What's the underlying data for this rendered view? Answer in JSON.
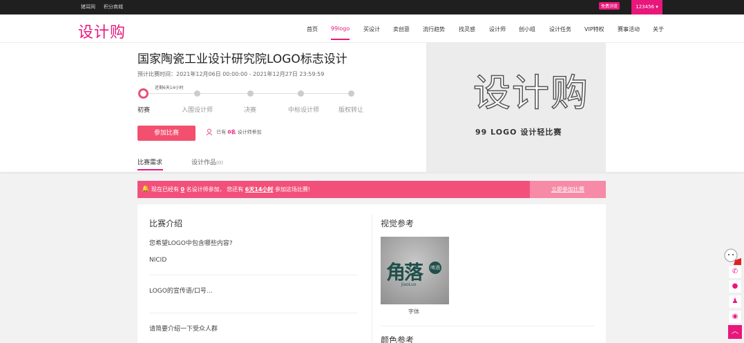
{
  "topbar": {
    "links": [
      "猪耳网",
      "积分商城"
    ],
    "user": "123456 ▾"
  },
  "nav": {
    "logo": "设计购",
    "items": [
      "首页",
      "99logo",
      "买设计",
      "卖创意",
      "流行趋势",
      "找灵感",
      "设计师",
      "创小组",
      "设计任务",
      "VIP特权",
      "赛事活动",
      "关于"
    ],
    "active_index": 1,
    "vip_badge": "免费浏览"
  },
  "contest": {
    "title": "国家陶瓷工业设计研究院LOGO标志设计",
    "time": "预计比赛时间：2021年12月06日 00:00:00 - 2021年12月27日 23:59:59",
    "remaining": "还剩6天14小时",
    "steps": [
      "初赛",
      "入围设计师",
      "决赛",
      "中标设计师",
      "版权转让"
    ],
    "join_button": "参加比赛",
    "joined_prefix": "已有",
    "joined_count": "0名",
    "joined_suffix": "设计师参加"
  },
  "tabs": [
    {
      "label": "比赛需求",
      "count": ""
    },
    {
      "label": "设计作品",
      "count": "(0)"
    }
  ],
  "banner": {
    "logo": "设计购",
    "subtitle": "99 LOGO 设计轻比赛"
  },
  "notice": {
    "prefix": "现在已经有",
    "count": "0",
    "mid": "名设计师参加， 您还有",
    "remain": "6天14小时",
    "suffix": "参加这场比赛!",
    "button": "立即参加比赛"
  },
  "intro": {
    "heading": "比赛介绍",
    "q1": "您希望LOGO中包含哪些内容?",
    "a1": "NICID",
    "q2": "LOGO的宣传语/口号...",
    "q3": "请简要介绍一下受众人群"
  },
  "visual": {
    "heading": "视觉参考",
    "ref_caption": "字体",
    "ref_text": "角落",
    "ref_small": "JiaoLuo",
    "ref_circle": "啤酒",
    "color_heading": "颜色参考"
  },
  "colors": {
    "accent": "#e8177b",
    "notice": "#f2507a"
  }
}
